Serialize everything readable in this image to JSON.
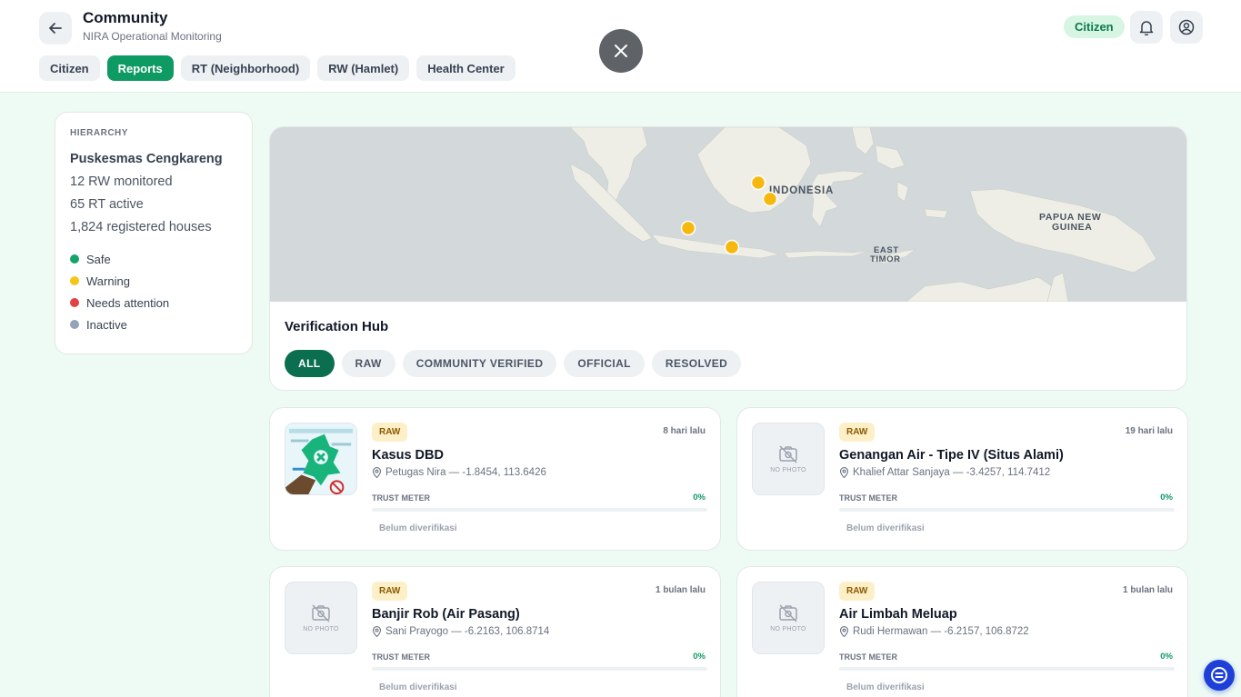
{
  "header": {
    "title": "Community",
    "subtitle": "NIRA Operational Monitoring",
    "tabs": [
      {
        "label": "Citizen",
        "active": false
      },
      {
        "label": "Reports",
        "active": true
      },
      {
        "label": "RT (Neighborhood)",
        "active": false
      },
      {
        "label": "RW (Hamlet)",
        "active": false
      },
      {
        "label": "Health Center",
        "active": false
      }
    ],
    "role_badge": "Citizen",
    "icons": {
      "back": "arrow-left-icon",
      "close": "close-icon",
      "notifications": "bell-icon",
      "account": "user-circle-icon"
    }
  },
  "hierarchy": {
    "label": "HIERARCHY",
    "name": "Puskesmas Cengkareng",
    "stats": [
      "12 RW monitored",
      "65 RT active",
      "1,824 registered houses"
    ],
    "legend": [
      {
        "label": "Safe",
        "color": "#16a36a"
      },
      {
        "label": "Warning",
        "color": "#f5c518"
      },
      {
        "label": "Needs attention",
        "color": "#e04343"
      },
      {
        "label": "Inactive",
        "color": "#94a3b8"
      }
    ]
  },
  "map": {
    "labels": {
      "indonesia": "INDONESIA",
      "east_timor_1": "EAST",
      "east_timor_2": "TIMOR",
      "png_1": "PAPUA NEW",
      "png_2": "GUINEA"
    },
    "marker_color": "#f6b80f"
  },
  "hub": {
    "title": "Verification Hub",
    "filters": [
      {
        "label": "ALL",
        "active": true
      },
      {
        "label": "RAW",
        "active": false
      },
      {
        "label": "COMMUNITY VERIFIED",
        "active": false
      },
      {
        "label": "OFFICIAL",
        "active": false
      },
      {
        "label": "RESOLVED",
        "active": false
      }
    ]
  },
  "reports": [
    {
      "badge": "RAW",
      "time": "8 hari lalu",
      "title": "Kasus DBD",
      "meta": "Petugas Nira — -1.8454, 113.6426",
      "trust_label": "TRUST METER",
      "trust_value": "0%",
      "trust_fraction": 0,
      "status": "Belum diverifikasi",
      "has_photo": true,
      "photo_text": ""
    },
    {
      "badge": "RAW",
      "time": "19 hari lalu",
      "title": "Genangan Air - Tipe IV (Situs Alami)",
      "meta": "Khalief Attar Sanjaya — -3.4257, 114.7412",
      "trust_label": "TRUST METER",
      "trust_value": "0%",
      "trust_fraction": 0,
      "status": "Belum diverifikasi",
      "has_photo": false,
      "photo_text": "NO PHOTO"
    },
    {
      "badge": "RAW",
      "time": "1 bulan lalu",
      "title": "Banjir Rob (Air Pasang)",
      "meta": "Sani Prayogo — -6.2163, 106.8714",
      "trust_label": "TRUST METER",
      "trust_value": "0%",
      "trust_fraction": 0,
      "status": "Belum diverifikasi",
      "has_photo": false,
      "photo_text": "NO PHOTO"
    },
    {
      "badge": "RAW",
      "time": "1 bulan lalu",
      "title": "Air Limbah Meluap",
      "meta": "Rudi Hermawan — -6.2157, 106.8722",
      "trust_label": "TRUST METER",
      "trust_value": "0%",
      "trust_fraction": 0,
      "status": "Belum diverifikasi",
      "has_photo": false,
      "photo_text": "NO PHOTO"
    }
  ]
}
